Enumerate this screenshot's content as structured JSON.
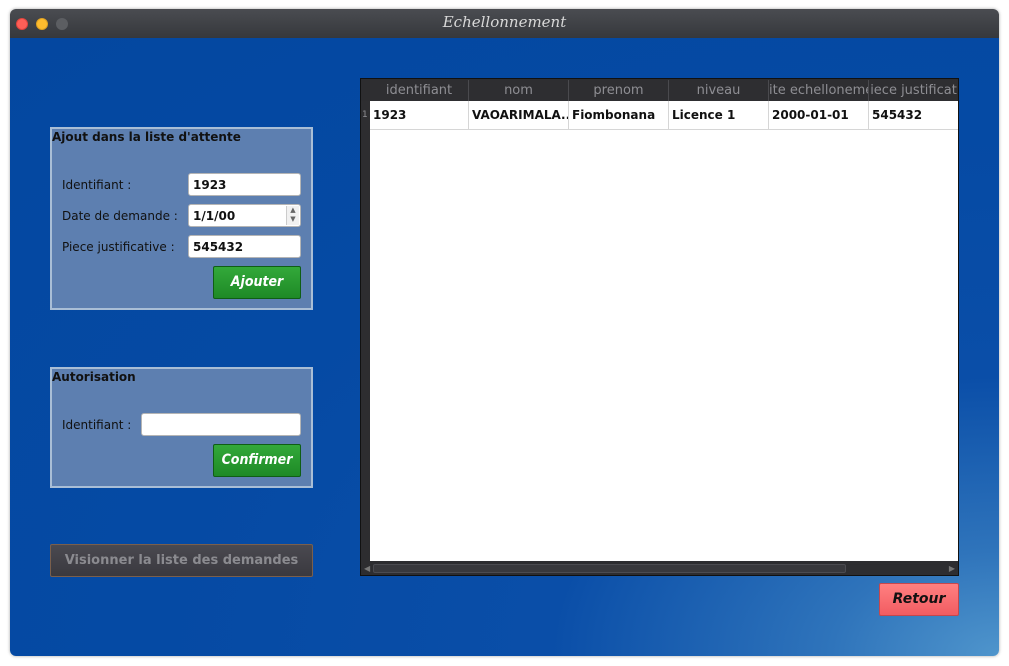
{
  "window": {
    "title": "Echellonnement"
  },
  "waitlist_group": {
    "title": "Ajout dans la liste d'attente",
    "identifiant_label": "Identifiant :",
    "identifiant_value": "1923",
    "date_label": "Date de demande :",
    "date_value": "1/1/00",
    "piece_label": "Piece justificative :",
    "piece_value": "545432",
    "add_button": "Ajouter"
  },
  "auth_group": {
    "title": "Autorisation",
    "identifiant_label": "Identifiant :",
    "identifiant_value": "",
    "confirm_button": "Confirmer"
  },
  "view_list_button": "Visionner la liste des demandes",
  "back_button": "Retour",
  "table": {
    "headers": [
      "identifiant",
      "nom",
      "prenom",
      "niveau",
      "ite echelloneme",
      "iece justificat"
    ],
    "row_numbers": [
      "1"
    ],
    "rows": [
      [
        "1923",
        "VAOARIMALA...",
        "Fiombonana",
        "Licence 1",
        "2000-01-01",
        "545432"
      ]
    ]
  },
  "colors": {
    "background": "#0447a0",
    "group_panel": "#5d7fb0",
    "green_button": "#1e8a26",
    "retour_button": "#f25c62"
  }
}
